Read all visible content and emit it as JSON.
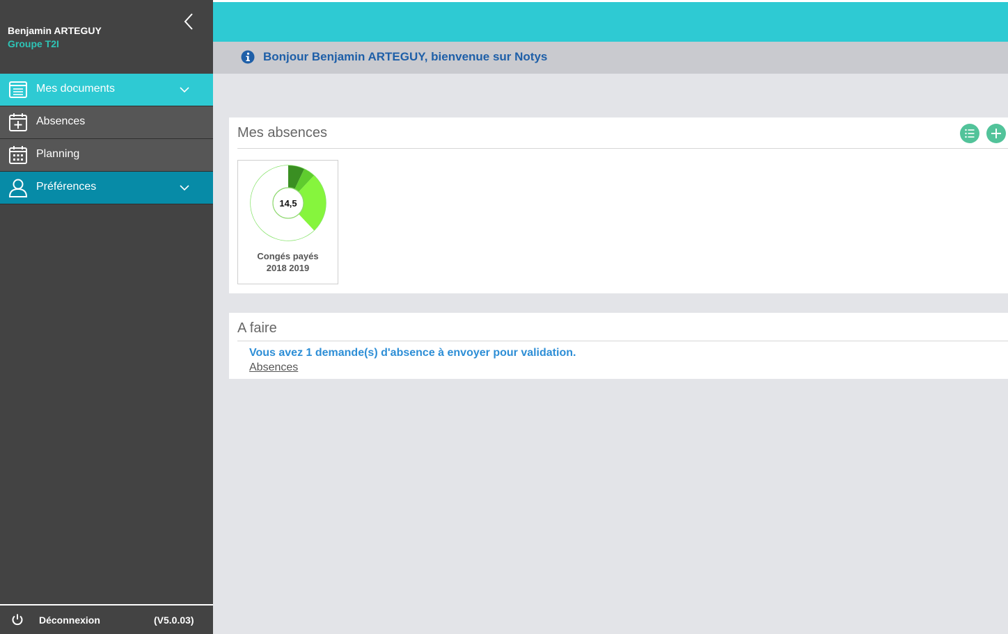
{
  "user": {
    "name": "Benjamin ARTEGUY",
    "group": "Groupe T2I"
  },
  "nav": {
    "items": [
      {
        "label": "Mes documents",
        "icon": "document-list-icon"
      },
      {
        "label": "Absences",
        "icon": "calendar-plus-icon"
      },
      {
        "label": "Planning",
        "icon": "calendar-grid-icon"
      },
      {
        "label": "Préférences",
        "icon": "user-icon"
      }
    ]
  },
  "footer": {
    "logout_label": "Déconnexion",
    "version": "(V5.0.03)"
  },
  "header": {
    "welcome": "Bonjour Benjamin ARTEGUY, bienvenue sur Notys"
  },
  "absences_card": {
    "title": "Mes absences",
    "tile": {
      "value": "14,5",
      "label_line1": "Congés payés",
      "label_line2": "2018 2019"
    }
  },
  "chart_data": {
    "type": "pie",
    "center_label": "14,5",
    "slices": [
      {
        "value": 7,
        "color": "#3a8f22"
      },
      {
        "value": 5,
        "color": "#5fcc2e"
      },
      {
        "value": 26,
        "color": "#86f53d"
      },
      {
        "value": 62,
        "color": "#ffffff"
      }
    ]
  },
  "todo_card": {
    "title": "A faire",
    "message": "Vous avez 1 demande(s) d'absence à envoyer pour validation.",
    "link": "Absences"
  },
  "colors": {
    "accent_cyan": "#2ecad3",
    "accent_blue": "#078ba7",
    "sidebar_bg": "#434343",
    "group_green": "#2ec4b6",
    "round_button": "#52c39a"
  }
}
